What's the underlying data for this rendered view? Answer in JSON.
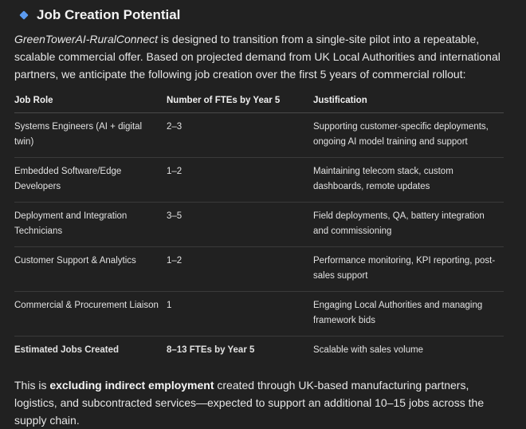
{
  "section": {
    "title": "Job Creation Potential",
    "icon": "diamond-bullet-icon",
    "accent_color": "#5b9bf0"
  },
  "intro": {
    "project_name": "GreenTowerAI-RuralConnect",
    "text_after": " is designed to transition from a single-site pilot into a repeatable, scalable commercial offer. Based on projected demand from UK Local Authorities and international partners, we anticipate the following job creation over the first 5 years of commercial rollout:"
  },
  "table": {
    "headers": [
      "Job Role",
      "Number of FTEs by Year 5",
      "Justification"
    ],
    "rows": [
      {
        "role": "Systems Engineers (AI + digital twin)",
        "ftes": "2–3",
        "justification": "Supporting customer-specific deployments, ongoing AI model training and support"
      },
      {
        "role": "Embedded Software/Edge Developers",
        "ftes": "1–2",
        "justification": "Maintaining telecom stack, custom dashboards, remote updates"
      },
      {
        "role": "Deployment and Integration Technicians",
        "ftes": "3–5",
        "justification": "Field deployments, QA, battery integration and commissioning"
      },
      {
        "role": "Customer Support & Analytics",
        "ftes": "1–2",
        "justification": "Performance monitoring, KPI reporting, post-sales support"
      },
      {
        "role": "Commercial & Procurement Liaison",
        "ftes": "1",
        "justification": "Engaging Local Authorities and managing framework bids"
      }
    ],
    "total": {
      "role": "Estimated Jobs Created",
      "ftes": "8–13 FTEs by Year 5",
      "justification": "Scalable with sales volume"
    }
  },
  "outro": {
    "prefix": "This is ",
    "bold": "excluding indirect employment",
    "suffix": " created through UK-based manufacturing partners, logistics, and subcontracted services—expected to support an additional 10–15 jobs across the supply chain."
  }
}
